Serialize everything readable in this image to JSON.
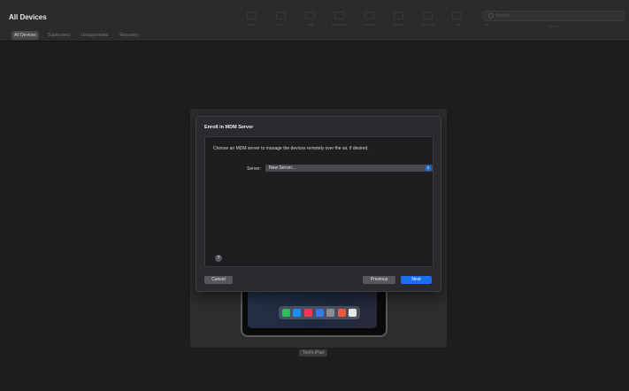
{
  "window": {
    "title": "All Devices"
  },
  "filters": [
    {
      "label": "All Devices",
      "active": true
    },
    {
      "label": "Supervised",
      "active": false
    },
    {
      "label": "Unsupervised",
      "active": false
    },
    {
      "label": "Recovery",
      "active": false
    }
  ],
  "toolbar": [
    {
      "label": "Back",
      "icon": "back-icon"
    },
    {
      "label": "View",
      "icon": "view-icon"
    },
    {
      "label": "Add",
      "icon": "add-icon"
    },
    {
      "label": "Blueprints",
      "icon": "blueprints-icon"
    },
    {
      "label": "Prepare",
      "icon": "prepare-icon"
    },
    {
      "label": "Update",
      "icon": "update-icon"
    },
    {
      "label": "Back Up",
      "icon": "backup-icon"
    },
    {
      "label": "Tag",
      "icon": "tag-icon"
    },
    {
      "label": "Info",
      "icon": "info-icon"
    }
  ],
  "search": {
    "placeholder": "Search",
    "label": "Search"
  },
  "device": {
    "name": "Test's iPad"
  },
  "dialog": {
    "title": "Enroll in MDM Server",
    "prompt": "Choose an MDM server to manage the devices remotely over the air, if desired.",
    "server_label": "Server:",
    "server_value": "New Server...",
    "help": "?",
    "cancel": "Cancel",
    "previous": "Previous",
    "next": "Next"
  },
  "colors": {
    "accent": "#1a6ef0",
    "background": "#1e1e20",
    "panel": "#2b2a2f"
  }
}
